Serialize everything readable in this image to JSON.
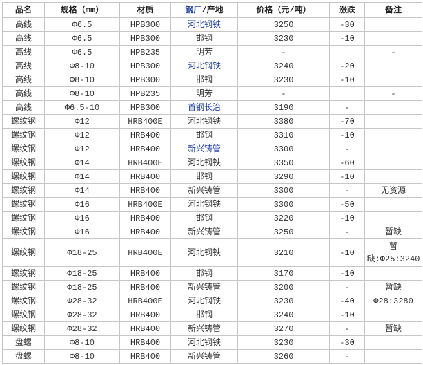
{
  "colors": {
    "text": "#333333",
    "link": "#2244aa",
    "border": "#c6c6c6"
  },
  "header": {
    "name": "品名",
    "spec": "规格（mm）",
    "material": "材质",
    "factory_link": "钢厂",
    "factory_rest": "/产地",
    "price": "价格（元/吨）",
    "change": "涨跌",
    "remark": "备注"
  },
  "rows": [
    {
      "name": "高线",
      "spec": "Φ6.5",
      "material": "HPB300",
      "factory": "河北钢铁",
      "price": "3250",
      "change": "-30"
    },
    {
      "name": "高线",
      "spec": "Φ6.5",
      "material": "HPB300",
      "factory": "邯钢",
      "price": "3230",
      "change": "-10"
    },
    {
      "name": "高线",
      "spec": "Φ6.5",
      "material": "HPB235",
      "factory": "明芳",
      "price": "-",
      "remark": "-"
    },
    {
      "name": "高线",
      "spec": "Φ8-10",
      "material": "HPB300",
      "factory": "河北钢铁",
      "price": "3240",
      "change": "-20"
    },
    {
      "name": "高线",
      "spec": "Φ8-10",
      "material": "HPB300",
      "factory": "邯钢",
      "price": "3230",
      "change": "-10"
    },
    {
      "name": "高线",
      "spec": "Φ8-10",
      "material": "HPB235",
      "factory": "明芳",
      "price": "-",
      "remark": "-"
    },
    {
      "name": "高线",
      "spec": "Φ6.5-10",
      "material": "HPB300",
      "factory": "首钢长治",
      "price": "3190",
      "change": "-"
    },
    {
      "name": "螺纹钢",
      "spec": "Φ12",
      "material": "HRB400E",
      "factory": "河北钢铁",
      "price": "3380",
      "change": "-70"
    },
    {
      "name": "螺纹钢",
      "spec": "Φ12",
      "material": "HRB400",
      "factory": "邯钢",
      "price": "3310",
      "change": "-10"
    },
    {
      "name": "螺纹钢",
      "spec": "Φ12",
      "material": "HRB400",
      "factory": "新兴铸管",
      "price": "3300",
      "change": "-"
    },
    {
      "name": "螺纹钢",
      "spec": "Φ14",
      "material": "HRB400E",
      "factory": "河北钢铁",
      "price": "3350",
      "change": "-60"
    },
    {
      "name": "螺纹钢",
      "spec": "Φ14",
      "material": "HRB400",
      "factory": "邯钢",
      "price": "3290",
      "change": "-10"
    },
    {
      "name": "螺纹钢",
      "spec": "Φ14",
      "material": "HRB400",
      "factory": "新兴铸管",
      "price": "3300",
      "change": "-",
      "remark": "无资源"
    },
    {
      "name": "螺纹钢",
      "spec": "Φ16",
      "material": "HRB400E",
      "factory": "河北钢铁",
      "price": "3300",
      "change": "-50"
    },
    {
      "name": "螺纹钢",
      "spec": "Φ16",
      "material": "HRB400",
      "factory": "邯钢",
      "price": "3220",
      "change": "-10"
    },
    {
      "name": "螺纹钢",
      "spec": "Φ16",
      "material": "HRB400",
      "factory": "新兴铸管",
      "price": "3250",
      "change": "-",
      "remark": "暂缺"
    },
    {
      "name": "螺纹钢",
      "spec": "Φ18-25",
      "material": "HRB400E",
      "factory": "河北钢铁",
      "price": "3210",
      "change": "-10",
      "remark": "暂缺;Φ25:3240"
    },
    {
      "name": "螺纹钢",
      "spec": "Φ18-25",
      "material": "HRB400",
      "factory": "邯钢",
      "price": "3170",
      "change": "-10"
    },
    {
      "name": "螺纹钢",
      "spec": "Φ18-25",
      "material": "HRB400",
      "factory": "新兴铸管",
      "price": "3200",
      "change": "-",
      "remark": "暂缺"
    },
    {
      "name": "螺纹钢",
      "spec": "Φ28-32",
      "material": "HRB400E",
      "factory": "河北钢铁",
      "price": "3230",
      "change": "-40",
      "remark": "Φ28:3280"
    },
    {
      "name": "螺纹钢",
      "spec": "Φ28-32",
      "material": "HRB400",
      "factory": "邯钢",
      "price": "3240",
      "change": "-10"
    },
    {
      "name": "螺纹钢",
      "spec": "Φ28-32",
      "material": "HRB400",
      "factory": "新兴铸管",
      "price": "3270",
      "change": "-",
      "remark": "暂缺"
    },
    {
      "name": "盘螺",
      "spec": "Φ8-10",
      "material": "HRB400",
      "factory": "河北钢铁",
      "price": "3230",
      "change": "-30"
    },
    {
      "name": "盘螺",
      "spec": "Φ8-10",
      "material": "HRB400",
      "factory": "新兴铸管",
      "price": "3260",
      "change": "-"
    }
  ]
}
